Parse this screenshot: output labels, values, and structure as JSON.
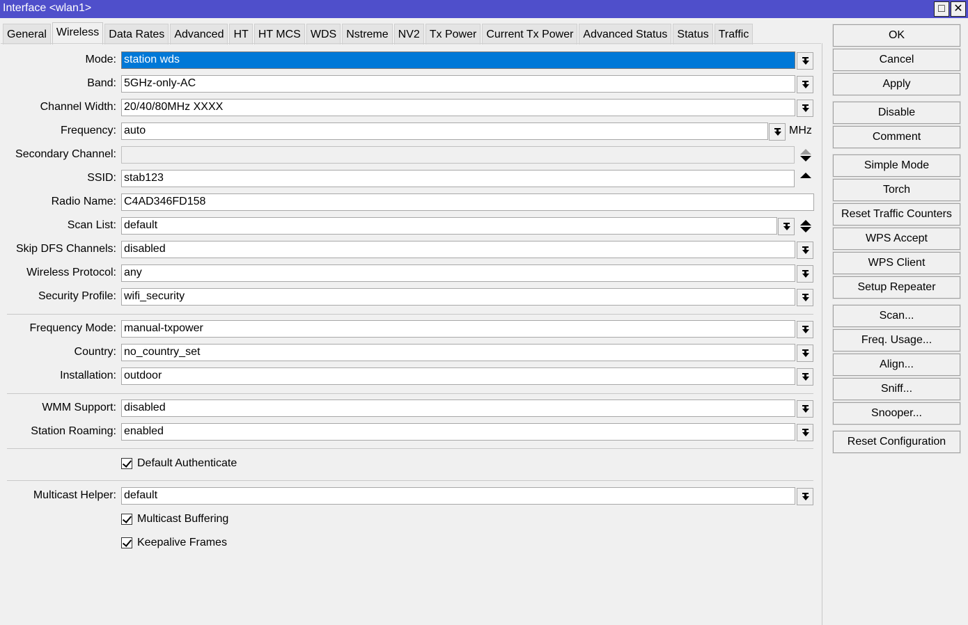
{
  "window": {
    "title": "Interface <wlan1>",
    "maximize": "□",
    "close": "✕"
  },
  "tabs": [
    "General",
    "Wireless",
    "Data Rates",
    "Advanced",
    "HT",
    "HT MCS",
    "WDS",
    "Nstreme",
    "NV2",
    "Tx Power",
    "Current Tx Power",
    "Advanced Status",
    "Status",
    "Traffic"
  ],
  "active_tab": "Wireless",
  "fields": {
    "mode": {
      "label": "Mode:",
      "value": "station wds"
    },
    "band": {
      "label": "Band:",
      "value": "5GHz-only-AC"
    },
    "channel_width": {
      "label": "Channel Width:",
      "value": "20/40/80MHz XXXX"
    },
    "frequency": {
      "label": "Frequency:",
      "value": "auto",
      "unit": "MHz"
    },
    "secondary_channel": {
      "label": "Secondary Channel:",
      "value": ""
    },
    "ssid": {
      "label": "SSID:",
      "value": "stab123"
    },
    "radio_name": {
      "label": "Radio Name:",
      "value": "C4AD346FD158"
    },
    "scan_list": {
      "label": "Scan List:",
      "value": "default"
    },
    "skip_dfs": {
      "label": "Skip DFS Channels:",
      "value": "disabled"
    },
    "wireless_protocol": {
      "label": "Wireless Protocol:",
      "value": "any"
    },
    "security_profile": {
      "label": "Security Profile:",
      "value": "wifi_security"
    },
    "frequency_mode": {
      "label": "Frequency Mode:",
      "value": "manual-txpower"
    },
    "country": {
      "label": "Country:",
      "value": "no_country_set"
    },
    "installation": {
      "label": "Installation:",
      "value": "outdoor"
    },
    "wmm_support": {
      "label": "WMM Support:",
      "value": "disabled"
    },
    "station_roaming": {
      "label": "Station Roaming:",
      "value": "enabled"
    },
    "multicast_helper": {
      "label": "Multicast Helper:",
      "value": "default"
    }
  },
  "checkboxes": {
    "default_authenticate": {
      "label": "Default Authenticate",
      "checked": true
    },
    "multicast_buffering": {
      "label": "Multicast Buffering",
      "checked": true
    },
    "keepalive_frames": {
      "label": "Keepalive Frames",
      "checked": true
    }
  },
  "buttons": [
    "OK",
    "Cancel",
    "Apply",
    "Disable",
    "Comment",
    "Simple Mode",
    "Torch",
    "Reset Traffic Counters",
    "WPS Accept",
    "WPS Client",
    "Setup Repeater",
    "Scan...",
    "Freq. Usage...",
    "Align...",
    "Sniff...",
    "Snooper...",
    "Reset Configuration"
  ]
}
